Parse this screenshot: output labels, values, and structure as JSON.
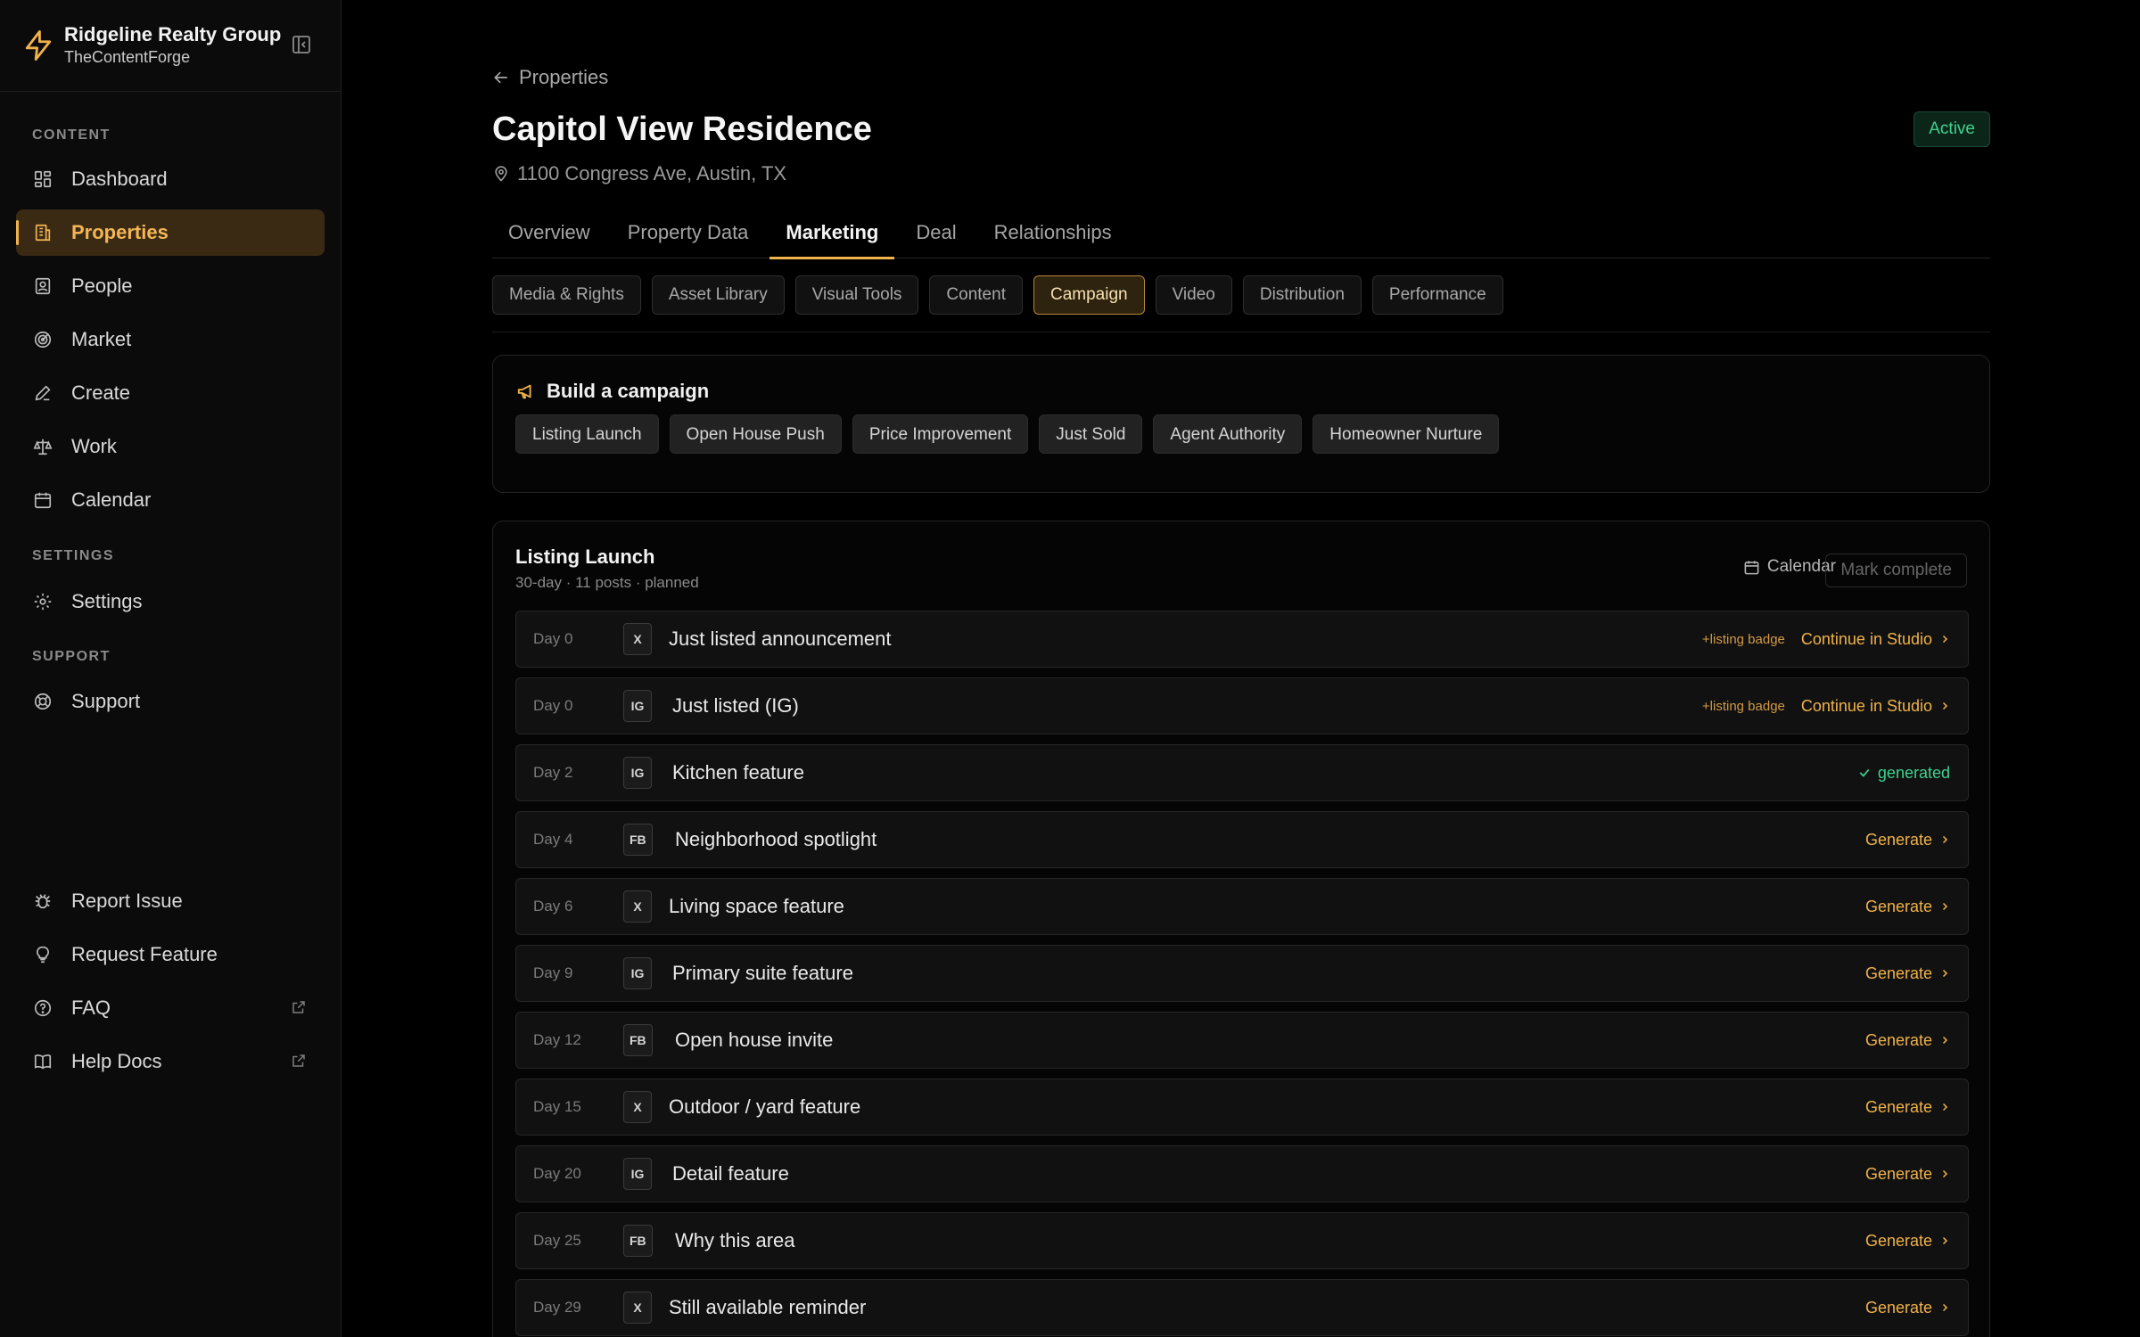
{
  "sidebar": {
    "brand_name": "Ridgeline Realty Group",
    "brand_sub": "TheContentForge",
    "sections": {
      "content": "CONTENT",
      "settings": "SETTINGS",
      "support": "SUPPORT"
    },
    "items": {
      "dashboard": "Dashboard",
      "properties": "Properties",
      "people": "People",
      "market": "Market",
      "create": "Create",
      "work": "Work",
      "calendar": "Calendar",
      "settings": "Settings",
      "support": "Support",
      "report": "Report Issue",
      "request": "Request Feature",
      "faq": "FAQ",
      "help": "Help Docs"
    },
    "active_item": "Properties"
  },
  "header": {
    "back_label": "Properties",
    "title": "Capitol View Residence",
    "address": "1100 Congress Ave, Austin, TX",
    "status": "Active"
  },
  "tabs": [
    "Overview",
    "Property Data",
    "Marketing",
    "Deal",
    "Relationships"
  ],
  "active_tab": "Marketing",
  "subtabs": [
    "Media & Rights",
    "Asset Library",
    "Visual Tools",
    "Content",
    "Campaign",
    "Video",
    "Distribution",
    "Performance"
  ],
  "active_subtab": "Campaign",
  "build": {
    "title": "Build a campaign",
    "presets": [
      "Listing Launch",
      "Open House Push",
      "Price Improvement",
      "Just Sold",
      "Agent Authority",
      "Homeowner Nurture"
    ]
  },
  "campaign": {
    "title": "Listing Launch",
    "meta": "30-day · 11 posts · planned",
    "calendar_label": "Calendar",
    "mark_complete_label": "Mark complete",
    "posts": [
      {
        "day": "Day 0",
        "platform": "X",
        "title": "Just listed announcement",
        "badge": "+listing badge",
        "action": "Continue in Studio"
      },
      {
        "day": "Day 0",
        "platform": "IG",
        "title": "Just listed (IG)",
        "badge": "+listing badge",
        "action": "Continue in Studio"
      },
      {
        "day": "Day 2",
        "platform": "IG",
        "title": "Kitchen feature",
        "status": "generated"
      },
      {
        "day": "Day 4",
        "platform": "FB",
        "title": "Neighborhood spotlight",
        "action": "Generate"
      },
      {
        "day": "Day 6",
        "platform": "X",
        "title": "Living space feature",
        "action": "Generate"
      },
      {
        "day": "Day 9",
        "platform": "IG",
        "title": "Primary suite feature",
        "action": "Generate"
      },
      {
        "day": "Day 12",
        "platform": "FB",
        "title": "Open house invite",
        "action": "Generate"
      },
      {
        "day": "Day 15",
        "platform": "X",
        "title": "Outdoor / yard feature",
        "action": "Generate"
      },
      {
        "day": "Day 20",
        "platform": "IG",
        "title": "Detail feature",
        "action": "Generate"
      },
      {
        "day": "Day 25",
        "platform": "FB",
        "title": "Why this area",
        "action": "Generate"
      },
      {
        "day": "Day 29",
        "platform": "X",
        "title": "Still available reminder",
        "action": "Generate"
      }
    ]
  },
  "colors": {
    "accent": "#f0b24a",
    "success": "#3fd18f",
    "background": "#000000"
  }
}
